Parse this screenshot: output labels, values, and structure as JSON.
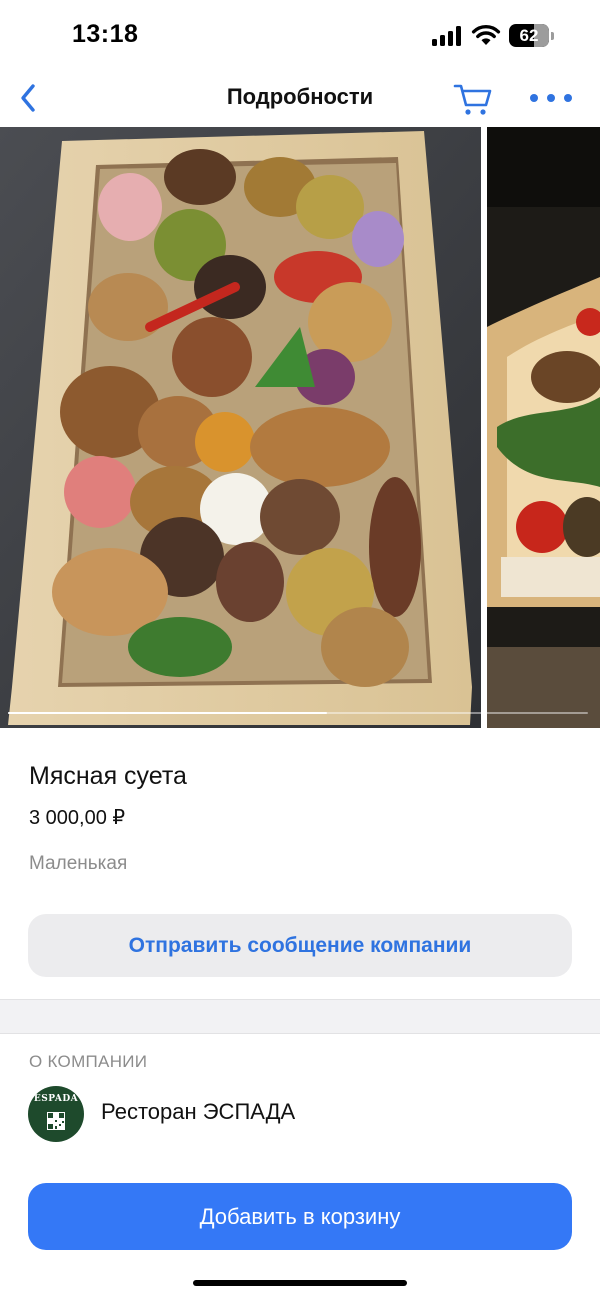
{
  "status_bar": {
    "time": "13:18",
    "battery_level": "62",
    "icons": [
      "signal-icon",
      "wifi-icon",
      "battery-icon"
    ]
  },
  "nav": {
    "title": "Подробности",
    "back_icon": "chevron-left-icon",
    "cart_icon": "cart-icon",
    "more_icon": "more-horizontal-icon",
    "accent_color": "#2f73e0"
  },
  "gallery": {
    "photo_count_visible": 2,
    "current_position_fraction": 0.55
  },
  "product": {
    "name": "Мясная суета",
    "price": "3 000,00 ₽",
    "variant": "Маленькая"
  },
  "actions": {
    "message_button": "Отправить сообщение компании",
    "add_to_cart_button": "Добавить в корзину",
    "primary_color": "#3478f6"
  },
  "company": {
    "section_label": "О КОМПАНИИ",
    "name": "Ресторан ЭСПАДА",
    "logo_text": "ESPADA"
  }
}
